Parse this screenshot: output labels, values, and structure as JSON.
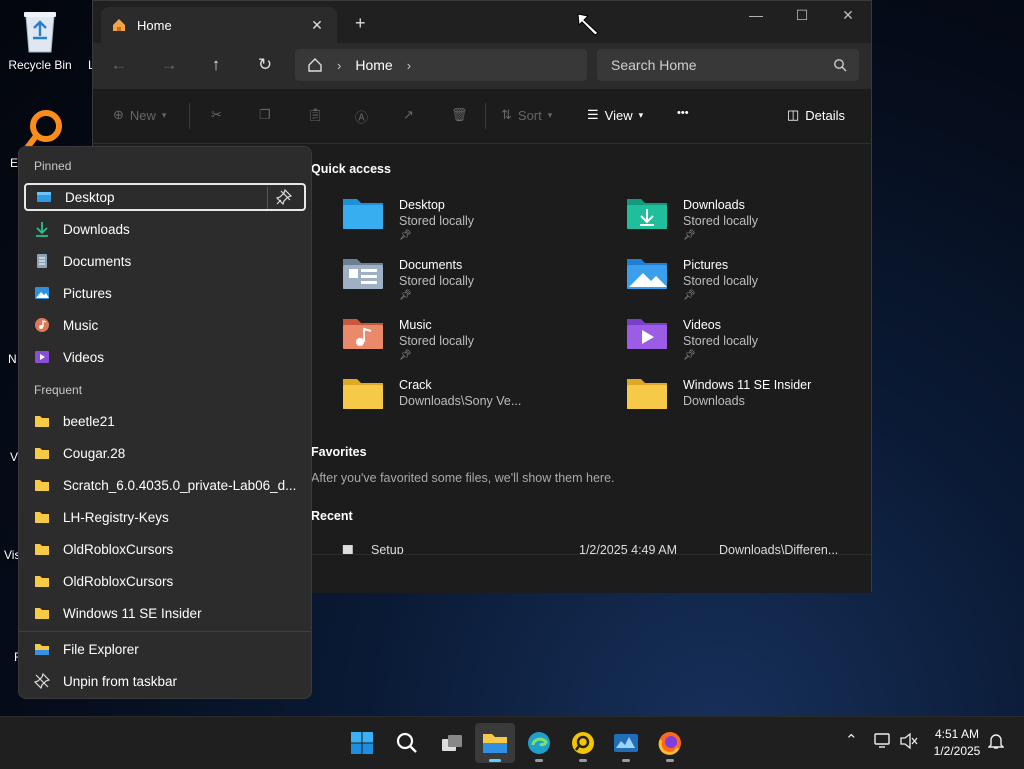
{
  "desktop": {
    "recycle_bin_label": "Recycle Bin",
    "edge_labels": [
      "L",
      "E",
      "N",
      "V",
      "Vis",
      "F"
    ]
  },
  "explorer": {
    "tab_title": "Home",
    "tab_close": "✕",
    "new_tab": "+",
    "window_controls": {
      "minimize": "—",
      "maximize": "☐",
      "close": "✕"
    },
    "breadcrumb": [
      "Home"
    ],
    "search_placeholder": "Search Home",
    "commands": {
      "new": "New",
      "sort": "Sort",
      "view": "View",
      "more": "•••",
      "details": "Details"
    },
    "quick_access": {
      "title": "Quick access",
      "items": [
        {
          "name": "Desktop",
          "sub": "Stored locally",
          "pinned": true,
          "icon": "desktop-folder-icon"
        },
        {
          "name": "Downloads",
          "sub": "Stored locally",
          "pinned": true,
          "icon": "downloads-folder-icon"
        },
        {
          "name": "Documents",
          "sub": "Stored locally",
          "pinned": true,
          "icon": "documents-folder-icon"
        },
        {
          "name": "Pictures",
          "sub": "Stored locally",
          "pinned": true,
          "icon": "pictures-folder-icon"
        },
        {
          "name": "Music",
          "sub": "Stored locally",
          "pinned": true,
          "icon": "music-folder-icon"
        },
        {
          "name": "Videos",
          "sub": "Stored locally",
          "pinned": true,
          "icon": "videos-folder-icon"
        },
        {
          "name": "Crack",
          "sub": "Downloads\\Sony Ve...",
          "pinned": false,
          "icon": "folder-icon"
        },
        {
          "name": "Windows 11 SE Insider",
          "sub": "Downloads",
          "pinned": false,
          "icon": "folder-icon"
        }
      ]
    },
    "favorites": {
      "title": "Favorites",
      "empty_text": "After you've favorited some files, we'll show them here."
    },
    "recent": {
      "title": "Recent",
      "rows": [
        {
          "name": "Setup",
          "date": "1/2/2025 4:49 AM",
          "location": "Downloads\\Differen..."
        }
      ]
    }
  },
  "jumplist": {
    "pinned_header": "Pinned",
    "pinned": [
      {
        "label": "Desktop",
        "icon": "desktop-icon",
        "selected": true
      },
      {
        "label": "Downloads",
        "icon": "download-icon"
      },
      {
        "label": "Documents",
        "icon": "document-icon"
      },
      {
        "label": "Pictures",
        "icon": "pictures-icon"
      },
      {
        "label": "Music",
        "icon": "music-icon"
      },
      {
        "label": "Videos",
        "icon": "videos-icon"
      }
    ],
    "frequent_header": "Frequent",
    "frequent": [
      "beetle21",
      "Cougar.28",
      "Scratch_6.0.4035.0_private-Lab06_d...",
      "LH-Registry-Keys",
      "OldRobloxCursors",
      "OldRobloxCursors",
      "Windows 11 SE Insider"
    ],
    "actions": [
      {
        "label": "File Explorer",
        "icon": "file-explorer-icon"
      },
      {
        "label": "Unpin from taskbar",
        "icon": "unpin-icon"
      }
    ]
  },
  "taskbar": {
    "apps": [
      "start-icon",
      "search-icon",
      "task-view-icon",
      "file-explorer-icon",
      "edge-icon",
      "app-orange-icon",
      "app-blue-icon",
      "firefox-icon"
    ],
    "active_app": "file-explorer-icon",
    "clock": {
      "time": "4:51 AM",
      "date": "1/2/2025"
    }
  },
  "colors": {
    "accent": "#60cdff",
    "folder_yellow": "#f7c948",
    "window_bg": "#1c1c1c",
    "flyout_bg": "#2c2c2c"
  }
}
